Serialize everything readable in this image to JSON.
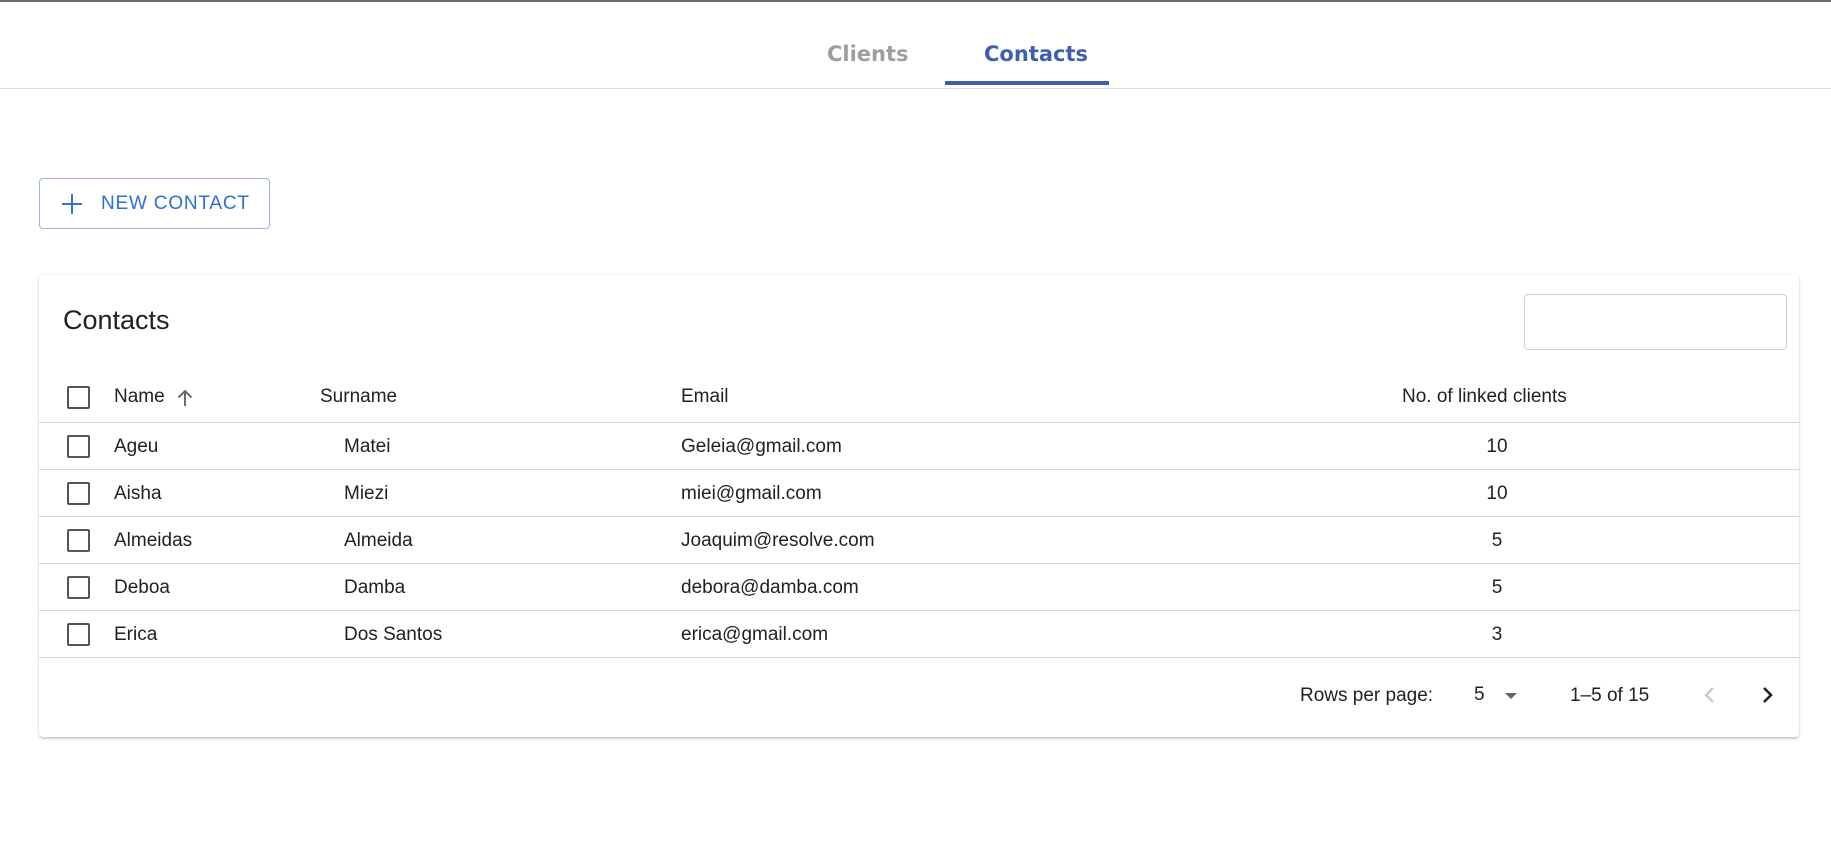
{
  "tabs": [
    {
      "label": "Clients",
      "active": false
    },
    {
      "label": "Contacts",
      "active": true
    }
  ],
  "toolbar": {
    "new_contact_label": "NEW CONTACT"
  },
  "card": {
    "title": "Contacts",
    "search": {
      "value": "",
      "placeholder": ""
    }
  },
  "table": {
    "columns": {
      "name": "Name",
      "surname": "Surname",
      "email": "Email",
      "linked": "No. of linked clients"
    },
    "sort": {
      "column": "name",
      "direction": "ascending"
    },
    "rows": [
      {
        "name": "Ageu",
        "surname": "Matei",
        "email": "Geleia@gmail.com",
        "linked": "10"
      },
      {
        "name": "Aisha",
        "surname": "Miezi",
        "email": "miei@gmail.com",
        "linked": "10"
      },
      {
        "name": "Almeidas",
        "surname": "Almeida",
        "email": "Joaquim@resolve.com",
        "linked": "5"
      },
      {
        "name": "Deboa",
        "surname": "Damba",
        "email": "debora@damba.com",
        "linked": "5"
      },
      {
        "name": "Erica",
        "surname": "Dos Santos",
        "email": "erica@gmail.com",
        "linked": "3"
      }
    ]
  },
  "pagination": {
    "rows_per_page_label": "Rows per page:",
    "rows_per_page": "5",
    "range": "1–5 of 15"
  },
  "icons": {
    "sort": "arrow-up-icon",
    "add": "plus-icon",
    "prev": "chevron-left-icon",
    "next": "chevron-right-icon",
    "dropdown": "caret-down-icon"
  },
  "colors": {
    "accent": "#3d5fae",
    "button": "#2f6fd0",
    "inactive_tab": "#9e9e9e"
  }
}
